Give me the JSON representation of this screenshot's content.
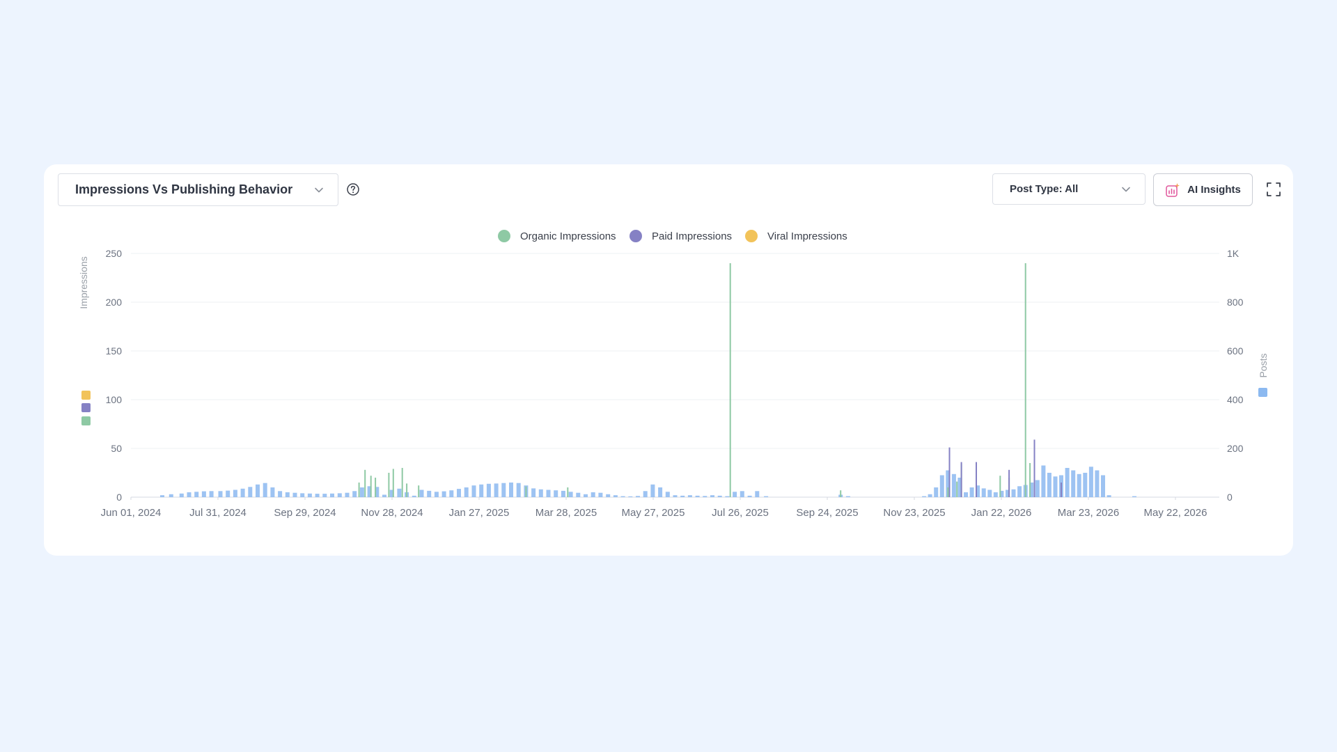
{
  "header": {
    "report_select_label": "Impressions Vs Publishing Behavior",
    "post_type_label": "Post Type: All",
    "ai_insights_label": "AI Insights"
  },
  "icons": {
    "report_dropdown": "chevron-down-icon",
    "help": "help-circle-icon",
    "post_type_dropdown": "chevron-down-icon",
    "ai_insights": "ai-chart-sparkle-icon",
    "fullscreen": "fullscreen-icon"
  },
  "colors": {
    "organic": "#8ec9a4",
    "paid": "#8581c4",
    "viral": "#f2c35a",
    "posts": "#8cb9f0"
  },
  "chart_data": {
    "type": "bar",
    "title": "",
    "legend": [
      {
        "name": "Organic Impressions",
        "color": "#8ec9a4"
      },
      {
        "name": "Paid Impressions",
        "color": "#8581c4"
      },
      {
        "name": "Viral Impressions",
        "color": "#f2c35a"
      }
    ],
    "legend_position": "top-center",
    "grid": true,
    "y_left": {
      "label": "Impressions",
      "ticks": [
        "0",
        "50",
        "100",
        "150",
        "200",
        "250"
      ],
      "ylim": [
        0,
        250
      ]
    },
    "y_right": {
      "label": "Posts",
      "ticks": [
        "0",
        "200",
        "400",
        "600",
        "800",
        "1K"
      ],
      "ylim": [
        0,
        1000
      ]
    },
    "x_axis": {
      "start": "2024-06-01",
      "end": "2026-06-01",
      "ticks": [
        "Jun 01, 2024",
        "Jul 31, 2024",
        "Sep 29, 2024",
        "Nov 28, 2024",
        "Jan 27, 2025",
        "Mar 28, 2025",
        "May 27, 2025",
        "Jul 26, 2025",
        "Sep 24, 2025",
        "Nov 23, 2025",
        "Jan 22, 2026",
        "Mar 23, 2026",
        "May 22, 2026"
      ]
    },
    "series": [
      {
        "name": "Organic Impressions",
        "axis": "left",
        "points": [
          [
            "2024-11-01",
            15
          ],
          [
            "2024-11-05",
            28
          ],
          [
            "2024-11-09",
            22
          ],
          [
            "2024-11-12",
            20
          ],
          [
            "2024-11-21",
            25
          ],
          [
            "2024-11-24",
            29
          ],
          [
            "2024-11-30",
            30
          ],
          [
            "2024-12-03",
            14
          ],
          [
            "2024-12-11",
            12
          ],
          [
            "2025-02-21",
            11
          ],
          [
            "2025-03-21",
            10
          ],
          [
            "2025-07-08",
            240
          ],
          [
            "2025-09-20",
            7
          ],
          [
            "2025-12-01",
            10
          ],
          [
            "2025-12-07",
            16
          ],
          [
            "2025-12-10",
            34
          ],
          [
            "2026-01-05",
            22
          ],
          [
            "2026-01-11",
            20
          ],
          [
            "2026-01-22",
            240
          ],
          [
            "2026-01-25",
            35
          ]
        ]
      },
      {
        "name": "Paid Impressions",
        "axis": "left",
        "points": [
          [
            "2025-12-02",
            51
          ],
          [
            "2025-12-10",
            36
          ],
          [
            "2025-12-20",
            36
          ],
          [
            "2026-01-11",
            28
          ],
          [
            "2026-01-28",
            59
          ],
          [
            "2026-02-15",
            15
          ]
        ]
      },
      {
        "name": "Viral Impressions",
        "axis": "left",
        "points": []
      },
      {
        "name": "Posts",
        "axis": "right",
        "points": [
          [
            "2024-06-22",
            8
          ],
          [
            "2024-06-28",
            12
          ],
          [
            "2024-07-05",
            15
          ],
          [
            "2024-07-10",
            20
          ],
          [
            "2024-07-15",
            22
          ],
          [
            "2024-07-20",
            24
          ],
          [
            "2024-07-25",
            25
          ],
          [
            "2024-07-31",
            25
          ],
          [
            "2024-08-05",
            27
          ],
          [
            "2024-08-10",
            30
          ],
          [
            "2024-08-15",
            35
          ],
          [
            "2024-08-20",
            42
          ],
          [
            "2024-08-25",
            52
          ],
          [
            "2024-08-30",
            58
          ],
          [
            "2024-09-04",
            40
          ],
          [
            "2024-09-09",
            25
          ],
          [
            "2024-09-14",
            20
          ],
          [
            "2024-09-19",
            18
          ],
          [
            "2024-09-24",
            16
          ],
          [
            "2024-09-29",
            15
          ],
          [
            "2024-10-04",
            14
          ],
          [
            "2024-10-09",
            14
          ],
          [
            "2024-10-14",
            15
          ],
          [
            "2024-10-19",
            16
          ],
          [
            "2024-10-24",
            18
          ],
          [
            "2024-10-29",
            25
          ],
          [
            "2024-11-03",
            40
          ],
          [
            "2024-11-08",
            45
          ],
          [
            "2024-11-13",
            42
          ],
          [
            "2024-11-18",
            10
          ],
          [
            "2024-11-23",
            30
          ],
          [
            "2024-11-28",
            35
          ],
          [
            "2024-12-03",
            20
          ],
          [
            "2024-12-08",
            6
          ],
          [
            "2024-12-13",
            30
          ],
          [
            "2024-12-18",
            26
          ],
          [
            "2024-12-23",
            22
          ],
          [
            "2024-12-28",
            24
          ],
          [
            "2025-01-02",
            28
          ],
          [
            "2025-01-07",
            34
          ],
          [
            "2025-01-12",
            40
          ],
          [
            "2025-01-17",
            48
          ],
          [
            "2025-01-22",
            52
          ],
          [
            "2025-01-27",
            55
          ],
          [
            "2025-02-01",
            56
          ],
          [
            "2025-02-06",
            58
          ],
          [
            "2025-02-11",
            60
          ],
          [
            "2025-02-16",
            58
          ],
          [
            "2025-02-21",
            48
          ],
          [
            "2025-02-26",
            36
          ],
          [
            "2025-03-03",
            32
          ],
          [
            "2025-03-08",
            30
          ],
          [
            "2025-03-13",
            28
          ],
          [
            "2025-03-18",
            26
          ],
          [
            "2025-03-23",
            22
          ],
          [
            "2025-03-28",
            18
          ],
          [
            "2025-04-02",
            12
          ],
          [
            "2025-04-07",
            20
          ],
          [
            "2025-04-12",
            18
          ],
          [
            "2025-04-17",
            12
          ],
          [
            "2025-04-22",
            8
          ],
          [
            "2025-04-27",
            4
          ],
          [
            "2025-05-02",
            3
          ],
          [
            "2025-05-07",
            5
          ],
          [
            "2025-05-12",
            25
          ],
          [
            "2025-05-17",
            52
          ],
          [
            "2025-05-22",
            40
          ],
          [
            "2025-05-27",
            22
          ],
          [
            "2025-06-01",
            8
          ],
          [
            "2025-06-06",
            6
          ],
          [
            "2025-06-11",
            8
          ],
          [
            "2025-06-16",
            6
          ],
          [
            "2025-06-21",
            5
          ],
          [
            "2025-06-26",
            8
          ],
          [
            "2025-07-01",
            6
          ],
          [
            "2025-07-06",
            4
          ],
          [
            "2025-07-11",
            22
          ],
          [
            "2025-07-16",
            25
          ],
          [
            "2025-07-21",
            6
          ],
          [
            "2025-07-26",
            25
          ],
          [
            "2025-08-01",
            4
          ],
          [
            "2025-09-20",
            10
          ],
          [
            "2025-09-25",
            4
          ],
          [
            "2025-11-15",
            4
          ],
          [
            "2025-11-19",
            12
          ],
          [
            "2025-11-23",
            40
          ],
          [
            "2025-11-27",
            90
          ],
          [
            "2025-12-01",
            110
          ],
          [
            "2025-12-05",
            95
          ],
          [
            "2025-12-09",
            80
          ],
          [
            "2025-12-13",
            20
          ],
          [
            "2025-12-17",
            40
          ],
          [
            "2025-12-21",
            48
          ],
          [
            "2025-12-25",
            36
          ],
          [
            "2025-12-29",
            30
          ],
          [
            "2026-01-02",
            20
          ],
          [
            "2026-01-06",
            26
          ],
          [
            "2026-01-10",
            30
          ],
          [
            "2026-01-14",
            32
          ],
          [
            "2026-01-18",
            45
          ],
          [
            "2026-01-22",
            50
          ],
          [
            "2026-01-26",
            60
          ],
          [
            "2026-01-30",
            70
          ],
          [
            "2026-02-03",
            130
          ],
          [
            "2026-02-07",
            100
          ],
          [
            "2026-02-11",
            85
          ],
          [
            "2026-02-15",
            90
          ],
          [
            "2026-02-19",
            120
          ],
          [
            "2026-02-23",
            110
          ],
          [
            "2026-02-27",
            95
          ],
          [
            "2026-03-03",
            100
          ],
          [
            "2026-03-07",
            125
          ],
          [
            "2026-03-11",
            110
          ],
          [
            "2026-03-15",
            90
          ],
          [
            "2026-03-19",
            8
          ],
          [
            "2026-04-05",
            4
          ]
        ]
      }
    ]
  }
}
